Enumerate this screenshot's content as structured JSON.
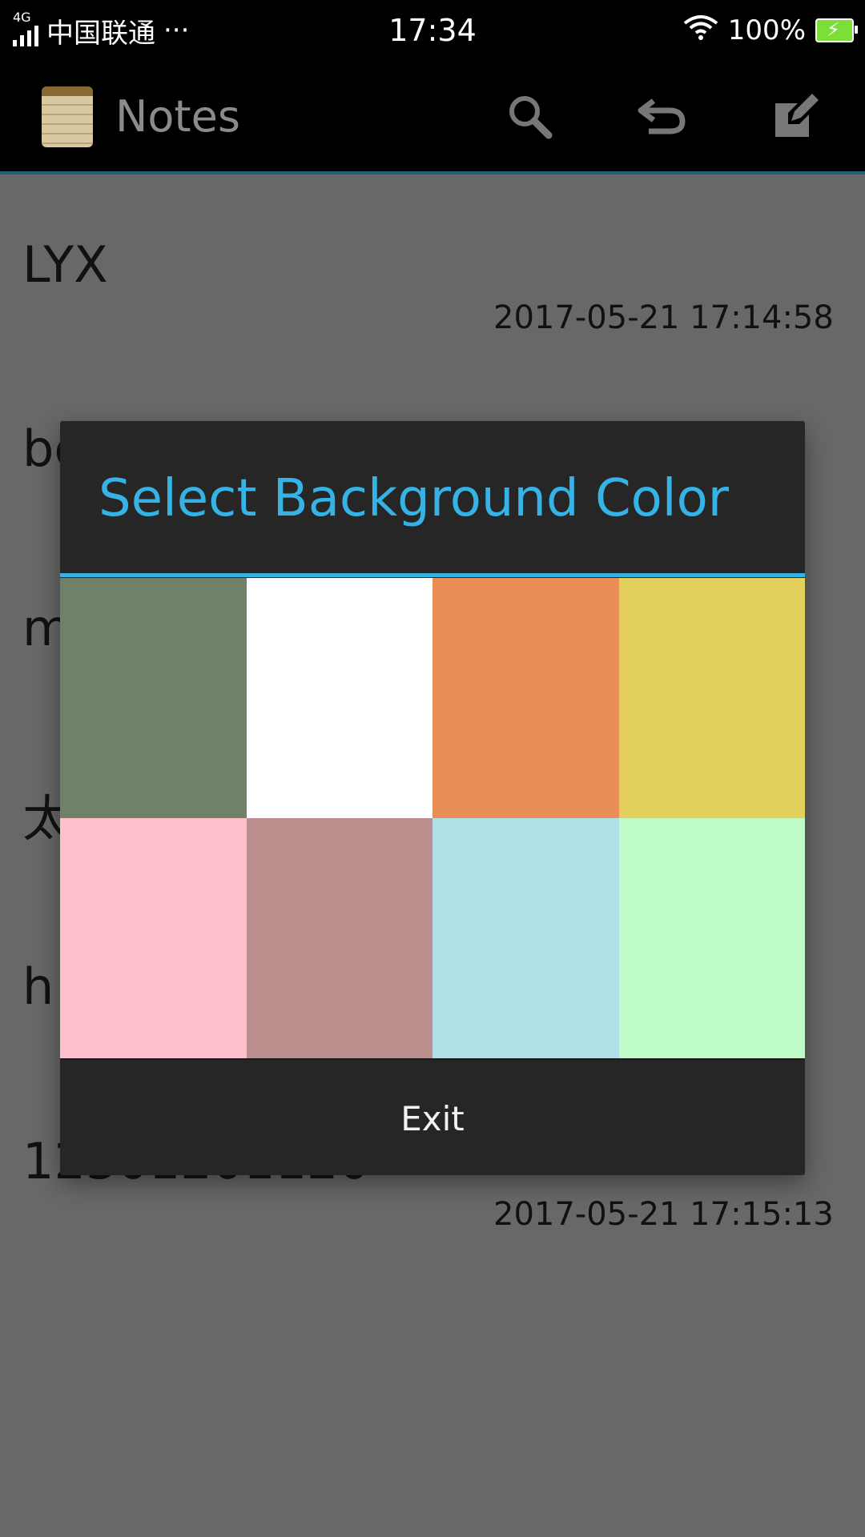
{
  "status_bar": {
    "network_type": "4G",
    "carrier": "中国联通",
    "more": "···",
    "time": "17:34",
    "battery": "100%"
  },
  "action_bar": {
    "title": "Notes",
    "icons": [
      "notepad-icon",
      "search-icon",
      "undo-icon",
      "compose-icon"
    ]
  },
  "notes": [
    {
      "title": "LYX",
      "time": "2017-05-21 17:14:58"
    },
    {
      "title": "bc",
      "time": ""
    },
    {
      "title": "m",
      "time": ""
    },
    {
      "title": "太",
      "time": ""
    },
    {
      "title": "h",
      "time": ""
    },
    {
      "title": "12301201120",
      "time": "2017-05-21 17:15:13"
    }
  ],
  "dialog": {
    "title": "Select Background Color",
    "accent": "#36b3e6",
    "colors": [
      "#718069",
      "#ffffff",
      "#ea8e58",
      "#e3cf5c",
      "#ffc0cb",
      "#bc8e8d",
      "#b0e0e6",
      "#befbc9"
    ],
    "exit_label": "Exit"
  }
}
